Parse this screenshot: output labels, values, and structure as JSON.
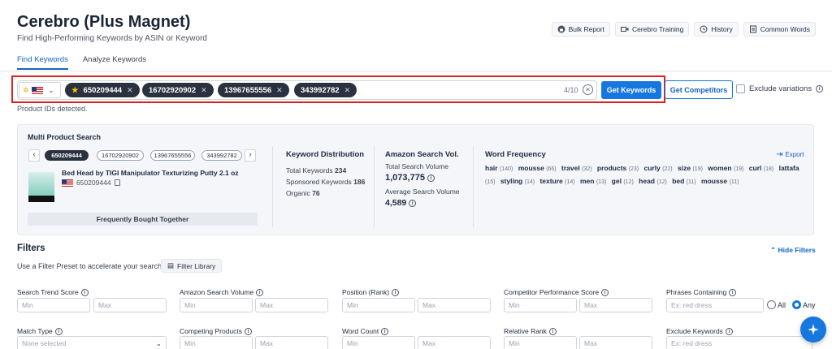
{
  "header": {
    "title": "Cerebro (Plus Magnet)",
    "subtitle": "Find High-Performing Keywords by ASIN or Keyword",
    "buttons": [
      "Bulk Report",
      "Cerebro Training",
      "History",
      "Common Words"
    ]
  },
  "tabs": [
    "Find Keywords",
    "Analyze Keywords"
  ],
  "search": {
    "chips": [
      "650209444",
      "16702920902",
      "13967655556",
      "343992782"
    ],
    "count": "4/10",
    "get_keywords": "Get Keywords",
    "get_competitors": "Get Competitors",
    "exclude_variations": "Exclude variations",
    "status": "Product IDs detected."
  },
  "multi_product": {
    "title": "Multi Product Search",
    "chips": [
      "650209444",
      "16702920902",
      "13967655556",
      "343992782"
    ],
    "product_title": "Bed Head by TIGI Manipulator Texturizing Putty 2.1 oz",
    "product_asin": "650209444",
    "frequently_bought": "Frequently Bought Together"
  },
  "keyword_distribution": {
    "title": "Keyword Distribution",
    "total_label": "Total Keywords",
    "total": "234",
    "sponsored_label": "Sponsored Keywords",
    "sponsored": "186",
    "organic_label": "Organic",
    "organic": "76"
  },
  "search_volume": {
    "title": "Amazon Search Vol.",
    "total_label": "Total Search Volume",
    "total": "1,073,775",
    "avg_label": "Average Search Volume",
    "avg": "4,589"
  },
  "word_frequency": {
    "title": "Word Frequency",
    "export": "Export",
    "words": [
      {
        "w": "hair",
        "n": "(140)"
      },
      {
        "w": "mousse",
        "n": "(66)"
      },
      {
        "w": "travel",
        "n": "(32)"
      },
      {
        "w": "products",
        "n": "(23)"
      },
      {
        "w": "curly",
        "n": "(22)"
      },
      {
        "w": "size",
        "n": "(19)"
      },
      {
        "w": "women",
        "n": "(19)"
      },
      {
        "w": "curl",
        "n": "(18)"
      },
      {
        "w": "lattafa",
        "n": "(15)"
      },
      {
        "w": "styling",
        "n": "(14)"
      },
      {
        "w": "texture",
        "n": "(14)"
      },
      {
        "w": "men",
        "n": "(13)"
      },
      {
        "w": "gel",
        "n": "(12)"
      },
      {
        "w": "head",
        "n": "(12)"
      },
      {
        "w": "bed",
        "n": "(11)"
      },
      {
        "w": "mousse",
        "n": "(11)"
      }
    ]
  },
  "filters": {
    "title": "Filters",
    "hide": "Hide Filters",
    "preset_text": "Use a Filter Preset to accelerate your search:",
    "library": "Filter Library",
    "row1": [
      "Search Trend Score",
      "Amazon Search Volume",
      "Position (Rank)",
      "Competitor Performance Score",
      "Phrases Containing"
    ],
    "row2": [
      "Match Type",
      "Competing Products",
      "Word Count",
      "Relative Rank",
      "Exclude Keywords"
    ],
    "min": "Min",
    "max": "Max",
    "phrase_placeholder": "Ex: red dress",
    "all": "All",
    "any": "Any",
    "match_placeholder": "None selected"
  }
}
